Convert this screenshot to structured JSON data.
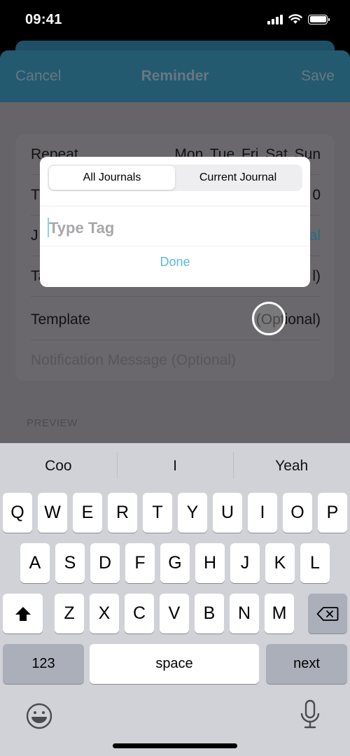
{
  "status_bar": {
    "time": "09:41",
    "icons": [
      "cellular-signal-icon",
      "wifi-icon",
      "battery-icon"
    ]
  },
  "navbar": {
    "cancel_label": "Cancel",
    "title": "Reminder",
    "save_label": "Save"
  },
  "form": {
    "rows": [
      {
        "label": "Repeat",
        "value": "Mon  Tue  Fri  Sat  Sun"
      },
      {
        "label": "T",
        "value": "0"
      },
      {
        "label": "J",
        "value": "al"
      },
      {
        "label": "Ta",
        "value": "l)"
      },
      {
        "label": "Template",
        "value": "(Optional)"
      }
    ],
    "notification_placeholder": "Notification Message (Optional)",
    "preview_label": "PREVIEW"
  },
  "dialog": {
    "segments": [
      {
        "label": "All Journals",
        "selected": true
      },
      {
        "label": "Current Journal",
        "selected": false
      }
    ],
    "tag_input": {
      "value": "",
      "placeholder": "Type Tag"
    },
    "done_label": "Done",
    "accent_color": "#5ab9de"
  },
  "keyboard": {
    "suggestions": [
      "Coo",
      "I",
      "Yeah"
    ],
    "row1": [
      "Q",
      "W",
      "E",
      "R",
      "T",
      "Y",
      "U",
      "I",
      "O",
      "P"
    ],
    "row2": [
      "A",
      "S",
      "D",
      "F",
      "G",
      "H",
      "J",
      "K",
      "L"
    ],
    "row3": [
      "Z",
      "X",
      "C",
      "V",
      "B",
      "N",
      "M"
    ],
    "numbers_label": "123",
    "space_label": "space",
    "next_label": "next",
    "shift_icon": "shift-icon",
    "delete_icon": "delete-backward-icon",
    "emoji_icon": "emoji-icon",
    "mic_icon": "microphone-icon"
  }
}
